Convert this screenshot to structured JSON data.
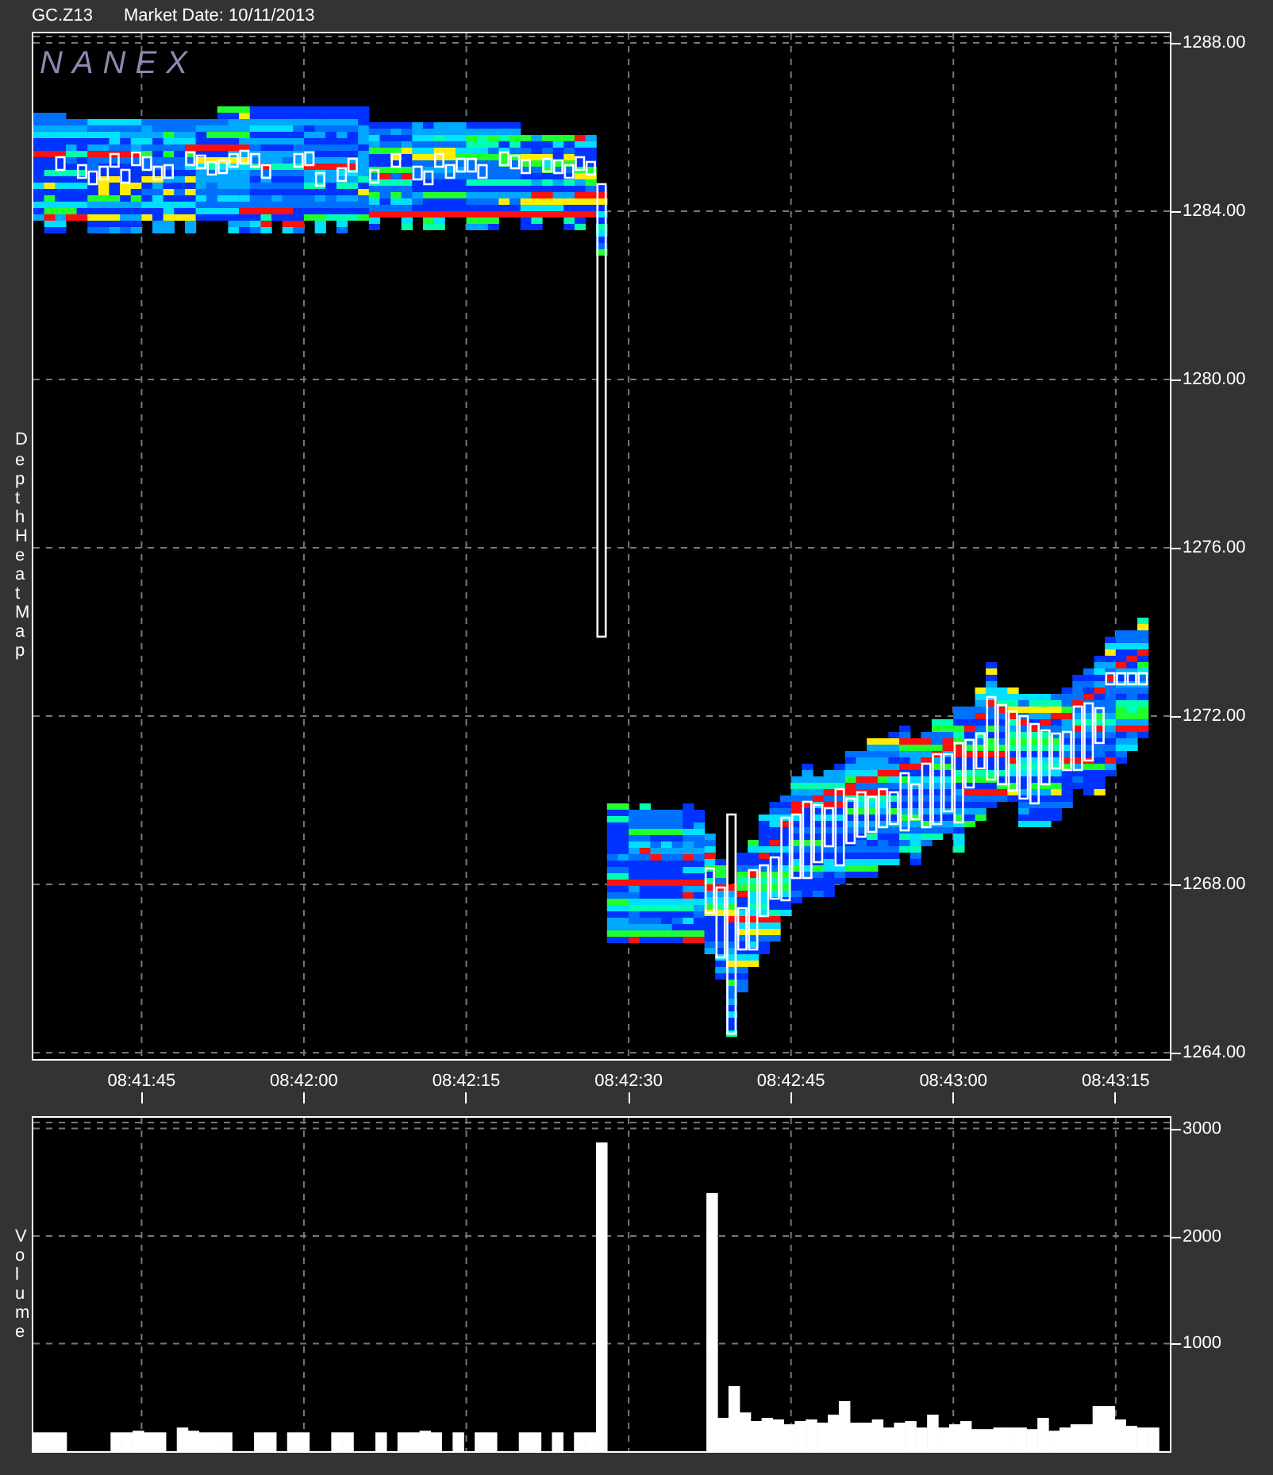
{
  "header": {
    "symbol": "GC.Z13",
    "market_date": "Market Date: 10/11/2013"
  },
  "price_chart": {
    "logo": "NANEX",
    "y_label": "Depth Heat Map",
    "price_ticks": [
      "1288.00",
      "1284.00",
      "1280.00",
      "1276.00",
      "1272.00",
      "1268.00",
      "1264.00"
    ],
    "time_ticks": [
      "08:41:45",
      "08:42:00",
      "08:42:15",
      "08:42:30",
      "08:42:45",
      "08:43:00",
      "08:43:15"
    ]
  },
  "volume_chart": {
    "chart_data": {
      "type": "bar",
      "ylabel": "Volume",
      "ylim": [
        0,
        3100
      ],
      "grid": true,
      "yticks": [
        {
          "value": 1000,
          "label": "1000"
        },
        {
          "value": 2000,
          "label": "2000"
        },
        {
          "value": 3000,
          "label": "3000"
        }
      ],
      "values": [
        175,
        175,
        175,
        null,
        null,
        null,
        null,
        175,
        175,
        190,
        175,
        175,
        null,
        220,
        190,
        175,
        175,
        175,
        null,
        null,
        175,
        175,
        null,
        175,
        175,
        null,
        null,
        175,
        175,
        null,
        null,
        175,
        null,
        175,
        175,
        190,
        175,
        null,
        175,
        null,
        175,
        175,
        null,
        null,
        175,
        175,
        null,
        175,
        null,
        175,
        175,
        2870,
        null,
        null,
        null,
        null,
        null,
        null,
        null,
        null,
        null,
        2400,
        310,
        605,
        360,
        280,
        310,
        295,
        250,
        280,
        295,
        265,
        340,
        465,
        265,
        265,
        295,
        220,
        265,
        280,
        220,
        340,
        220,
        250,
        280,
        205,
        205,
        220,
        220,
        220,
        205,
        310,
        190,
        220,
        250,
        250,
        420,
        420,
        295,
        235,
        220,
        220,
        null
      ]
    }
  }
}
